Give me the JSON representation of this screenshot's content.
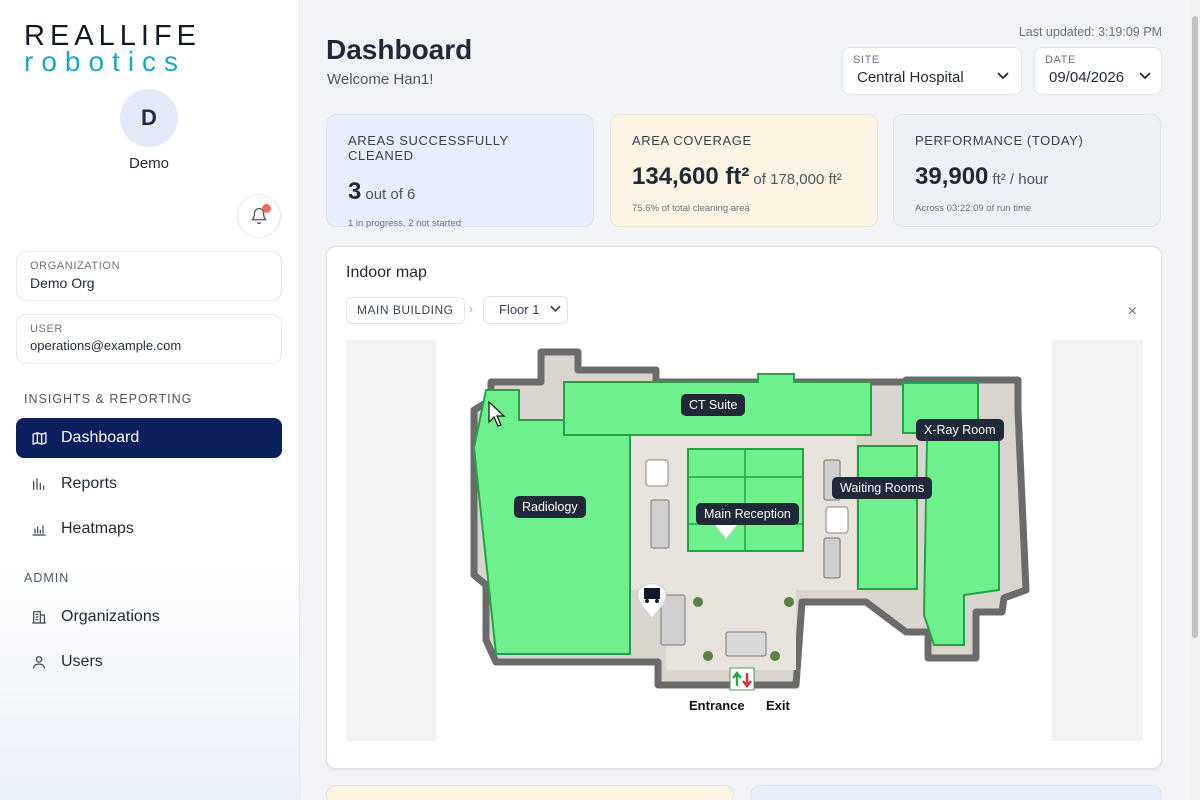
{
  "brand": {
    "line1": "REALLIFE",
    "line2": "robotics"
  },
  "user": {
    "initial": "D",
    "name": "Demo"
  },
  "organization": {
    "label": "ORGANIZATION",
    "value": "Demo Org"
  },
  "user_box": {
    "label": "USER",
    "value": "operations@example.com"
  },
  "nav": {
    "section_insights": "INSIGHTS & REPORTING",
    "dashboard": "Dashboard",
    "reports": "Reports",
    "heatmaps": "Heatmaps",
    "section_admin": "ADMIN",
    "organizations": "Organizations",
    "users": "Users"
  },
  "header": {
    "title": "Dashboard",
    "welcome": "Welcome Han1!",
    "last_updated": "Last updated: 3:19:09 PM"
  },
  "site": {
    "label": "SITE",
    "value": "Central Hospital"
  },
  "date": {
    "label": "DATE",
    "value": "09/04/2026"
  },
  "stats": {
    "areas": {
      "label": "AREAS SUCCESSFULLY CLEANED",
      "value": "3",
      "unit": "out of 6",
      "sub": "1 in progress, 2 not started"
    },
    "coverage": {
      "label": "AREA COVERAGE",
      "value": "134,600 ft²",
      "unit": "of 178,000 ft²",
      "sub": "75.6% of total cleaning area"
    },
    "performance": {
      "label": "PERFORMANCE (TODAY)",
      "value": "39,900",
      "unit": "ft² / hour",
      "sub": "Across 03:22:09 of run time"
    }
  },
  "map": {
    "title": "Indoor map",
    "building": "MAIN BUILDING",
    "separator": "›",
    "floor": "Floor 1",
    "close": "×",
    "rooms": {
      "ct_suite": "CT Suite",
      "xray": "X-Ray Room",
      "waiting": "Waiting Rooms",
      "radiology": "Radiology",
      "reception": "Main Reception"
    },
    "entrance": "Entrance",
    "exit": "Exit"
  },
  "colors": {
    "nav_active": "#0b1f5e",
    "card_blue": "#e8eefb",
    "card_yellow": "#fbf4e2",
    "card_gray": "#edf0f5",
    "cleaned_green": "#6ef08c"
  }
}
